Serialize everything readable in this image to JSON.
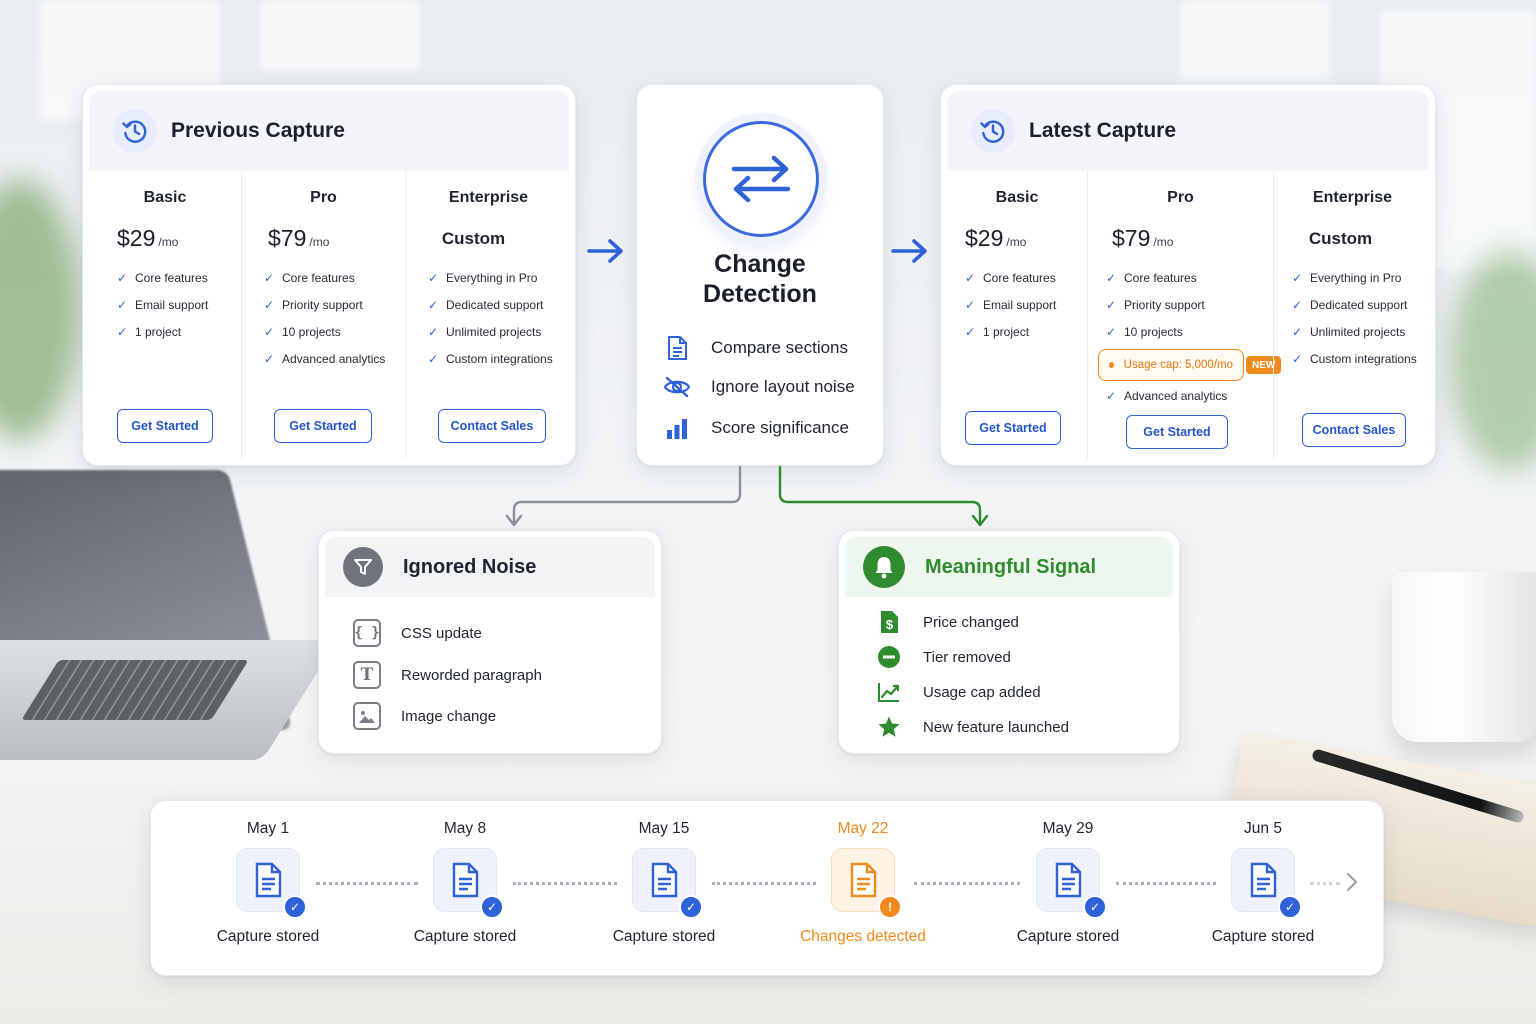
{
  "previous_capture": {
    "title": "Previous Capture",
    "tiers": [
      {
        "name": "Basic",
        "price": "$29",
        "per": "/mo",
        "features": [
          "Core features",
          "Email support",
          "1 project"
        ],
        "button": "Get Started"
      },
      {
        "name": "Pro",
        "price": "$79",
        "per": "/mo",
        "features": [
          "Core features",
          "Priority support",
          "10 projects",
          "Advanced analytics"
        ],
        "button": "Get Started"
      },
      {
        "name": "Enterprise",
        "price": "Custom",
        "features": [
          "Everything in Pro",
          "Dedicated support",
          "Unlimited projects",
          "Custom integrations"
        ],
        "button": "Contact Sales"
      }
    ]
  },
  "latest_capture": {
    "title": "Latest Capture",
    "tiers": [
      {
        "name": "Basic",
        "price": "$29",
        "per": "/mo",
        "features": [
          "Core features",
          "Email support",
          "1 project"
        ],
        "button": "Get Started"
      },
      {
        "name": "Pro",
        "price": "$79",
        "per": "/mo",
        "features": [
          "Core features",
          "Priority support",
          "10 projects"
        ],
        "usage_cap": "Usage cap: 5,000/mo",
        "new_badge": "NEW",
        "extra_feature": "Advanced analytics",
        "button": "Get Started"
      },
      {
        "name": "Enterprise",
        "price": "Custom",
        "features": [
          "Everything in Pro",
          "Dedicated support",
          "Unlimited projects",
          "Custom integrations"
        ],
        "button": "Contact Sales"
      }
    ]
  },
  "change_detection": {
    "title_line1": "Change",
    "title_line2": "Detection",
    "items": [
      {
        "label": "Compare sections",
        "icon": "document-icon"
      },
      {
        "label": "Ignore layout noise",
        "icon": "eye-off-icon"
      },
      {
        "label": "Score significance",
        "icon": "bar-chart-icon"
      }
    ]
  },
  "ignored_noise": {
    "title": "Ignored Noise",
    "items": [
      {
        "label": "CSS update",
        "icon": "code-braces-icon"
      },
      {
        "label": "Reworded paragraph",
        "icon": "text-icon"
      },
      {
        "label": "Image change",
        "icon": "image-icon"
      }
    ]
  },
  "meaningful_signal": {
    "title": "Meaningful Signal",
    "items": [
      {
        "label": "Price changed",
        "icon": "price-tag-icon"
      },
      {
        "label": "Tier removed",
        "icon": "minus-circle-icon"
      },
      {
        "label": "Usage cap added",
        "icon": "trend-up-icon"
      },
      {
        "label": "New feature launched",
        "icon": "star-icon"
      }
    ]
  },
  "timeline": [
    {
      "date": "May 1",
      "status": "Capture stored",
      "state": "ok"
    },
    {
      "date": "May 8",
      "status": "Capture stored",
      "state": "ok"
    },
    {
      "date": "May 15",
      "status": "Capture stored",
      "state": "ok"
    },
    {
      "date": "May 22",
      "status": "Changes detected",
      "state": "warn"
    },
    {
      "date": "May 29",
      "status": "Capture stored",
      "state": "ok"
    },
    {
      "date": "Jun 5",
      "status": "Capture stored",
      "state": "ok"
    }
  ],
  "colors": {
    "accent": "#2f62d6",
    "warning": "#f08a1c",
    "signal": "#2e8b2e",
    "noise": "#6f747c"
  }
}
